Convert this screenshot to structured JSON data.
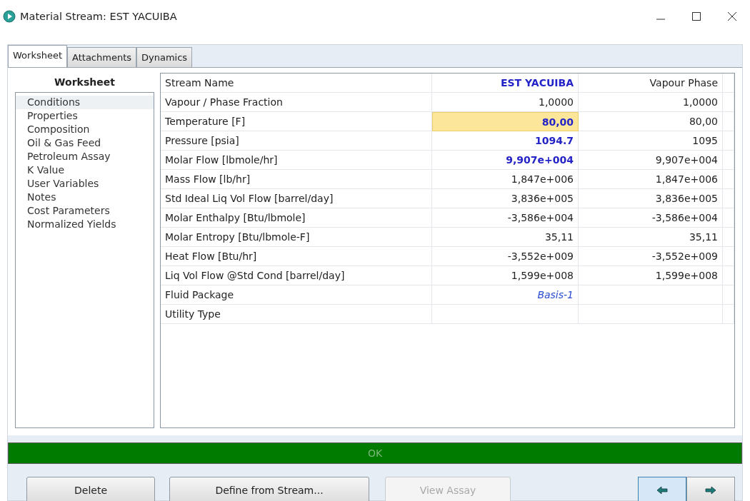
{
  "window": {
    "title": "Material Stream: EST YACUIBA"
  },
  "tabs": [
    {
      "label": "Worksheet",
      "selected": true
    },
    {
      "label": "Attachments",
      "selected": false
    },
    {
      "label": "Dynamics",
      "selected": false
    }
  ],
  "sidebar": {
    "heading": "Worksheet",
    "items": [
      {
        "label": "Conditions",
        "selected": true
      },
      {
        "label": "Properties",
        "selected": false
      },
      {
        "label": "Composition",
        "selected": false
      },
      {
        "label": "Oil & Gas Feed",
        "selected": false
      },
      {
        "label": "Petroleum Assay",
        "selected": false
      },
      {
        "label": "K Value",
        "selected": false
      },
      {
        "label": "User Variables",
        "selected": false
      },
      {
        "label": "Notes",
        "selected": false
      },
      {
        "label": "Cost Parameters",
        "selected": false
      },
      {
        "label": "Normalized Yields",
        "selected": false
      }
    ]
  },
  "table": {
    "rows": [
      {
        "label": "Stream Name",
        "value": {
          "text": "EST YACUIBA",
          "kind": "specified",
          "selected": false
        },
        "phase": "Vapour Phase"
      },
      {
        "label": "Vapour / Phase Fraction",
        "value": {
          "text": "1,0000",
          "kind": "calculated",
          "selected": false
        },
        "phase": "1,0000"
      },
      {
        "label": "Temperature [F]",
        "value": {
          "text": "80,00",
          "kind": "specified",
          "selected": true
        },
        "phase": "80,00"
      },
      {
        "label": "Pressure [psia]",
        "value": {
          "text": "1094.7",
          "kind": "specified",
          "selected": false
        },
        "phase": "1095"
      },
      {
        "label": "Molar Flow [lbmole/hr]",
        "value": {
          "text": "9,907e+004",
          "kind": "specified",
          "selected": false
        },
        "phase": "9,907e+004"
      },
      {
        "label": "Mass Flow [lb/hr]",
        "value": {
          "text": "1,847e+006",
          "kind": "calculated",
          "selected": false
        },
        "phase": "1,847e+006"
      },
      {
        "label": "Std Ideal Liq Vol Flow [barrel/day]",
        "value": {
          "text": "3,836e+005",
          "kind": "calculated",
          "selected": false
        },
        "phase": "3,836e+005"
      },
      {
        "label": "Molar Enthalpy [Btu/lbmole]",
        "value": {
          "text": "-3,586e+004",
          "kind": "calculated",
          "selected": false
        },
        "phase": "-3,586e+004"
      },
      {
        "label": "Molar Entropy [Btu/lbmole-F]",
        "value": {
          "text": "35,11",
          "kind": "calculated",
          "selected": false
        },
        "phase": "35,11"
      },
      {
        "label": "Heat Flow [Btu/hr]",
        "value": {
          "text": "-3,552e+009",
          "kind": "calculated",
          "selected": false
        },
        "phase": "-3,552e+009"
      },
      {
        "label": "Liq Vol Flow @Std Cond [barrel/day]",
        "value": {
          "text": "1,599e+008",
          "kind": "calculated",
          "selected": false
        },
        "phase": "1,599e+008"
      },
      {
        "label": "Fluid Package",
        "value": {
          "text": "Basis-1",
          "kind": "link",
          "selected": false
        }
      },
      {
        "label": "Utility Type"
      }
    ]
  },
  "status_bar": {
    "text": "OK"
  },
  "buttons": [
    {
      "label": "Delete",
      "disabled": false
    },
    {
      "label": "Define from Stream...",
      "disabled": false
    },
    {
      "label": "View Assay",
      "disabled": true
    }
  ],
  "nav_buttons": [
    {
      "kind": "left",
      "selected": true
    },
    {
      "kind": "right",
      "selected": false
    }
  ]
}
